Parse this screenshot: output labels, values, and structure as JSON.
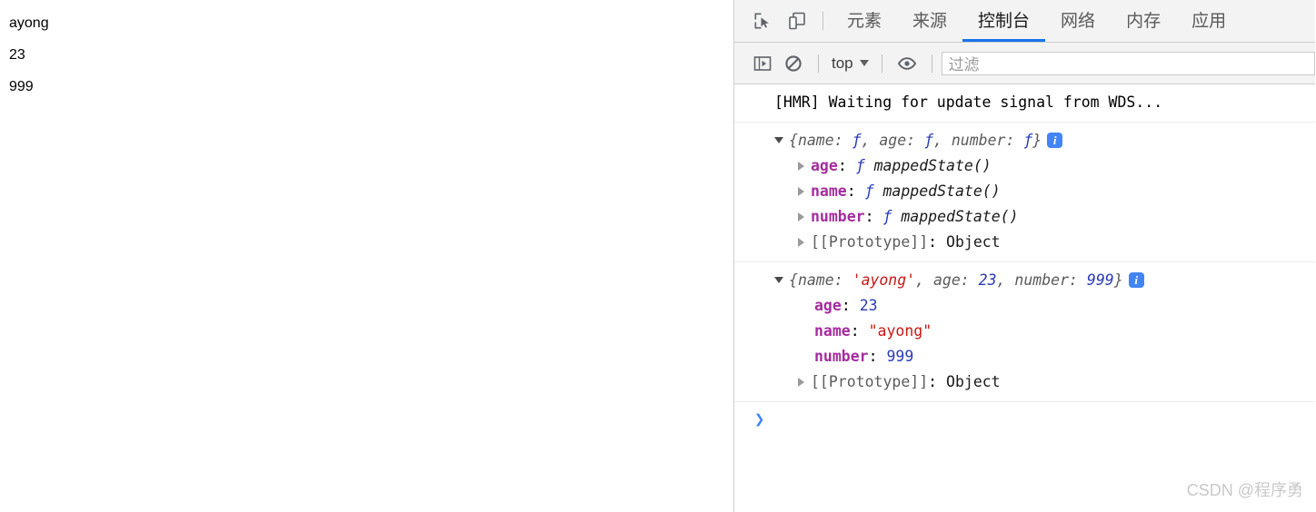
{
  "page": {
    "lines": [
      "ayong",
      "23",
      "999"
    ]
  },
  "devtools": {
    "toolbar_icons": {
      "inspect": "inspect-element-icon",
      "device": "device-toolbar-icon"
    },
    "tabs": [
      {
        "label": "元素",
        "active": false
      },
      {
        "label": "来源",
        "active": false
      },
      {
        "label": "控制台",
        "active": true
      },
      {
        "label": "网络",
        "active": false
      },
      {
        "label": "内存",
        "active": false
      },
      {
        "label": "应用",
        "active": false
      }
    ],
    "console_toolbar": {
      "sidebar_toggle": "console-sidebar-icon",
      "clear_console": "clear-console-icon",
      "context": "top",
      "eye": "live-expression-icon",
      "filter_placeholder": "过滤"
    },
    "console": {
      "messages": [
        {
          "type": "log",
          "text": "[HMR] Waiting for update signal from WDS..."
        },
        {
          "type": "object",
          "preview_open": "{",
          "preview_items": [
            {
              "key": "name",
              "value": "ƒ"
            },
            {
              "key": "age",
              "value": "ƒ"
            },
            {
              "key": "number",
              "value": "ƒ"
            }
          ],
          "preview_close": "}",
          "badge": "info-badge",
          "props": [
            {
              "key": "age",
              "kw": "ƒ",
              "value": "mappedState()",
              "kind": "function",
              "expandable": true
            },
            {
              "key": "name",
              "kw": "ƒ",
              "value": "mappedState()",
              "kind": "function",
              "expandable": true
            },
            {
              "key": "number",
              "kw": "ƒ",
              "value": "mappedState()",
              "kind": "function",
              "expandable": true
            },
            {
              "key": "[[Prototype]]",
              "value": "Object",
              "kind": "object",
              "expandable": true
            }
          ]
        },
        {
          "type": "object",
          "preview_open": "{",
          "preview_items": [
            {
              "key": "name",
              "value": "'ayong'",
              "kind": "string"
            },
            {
              "key": "age",
              "value": "23",
              "kind": "number"
            },
            {
              "key": "number",
              "value": "999",
              "kind": "number"
            }
          ],
          "preview_close": "}",
          "badge": "info-badge",
          "props": [
            {
              "key": "age",
              "value": "23",
              "kind": "number",
              "expandable": false
            },
            {
              "key": "name",
              "value": "\"ayong\"",
              "kind": "string",
              "expandable": false
            },
            {
              "key": "number",
              "value": "999",
              "kind": "number",
              "expandable": false
            },
            {
              "key": "[[Prototype]]",
              "value": "Object",
              "kind": "object",
              "expandable": true
            }
          ]
        }
      ],
      "prompt_caret": "❯"
    }
  },
  "watermark": "CSDN @程序勇",
  "colors": {
    "accent": "#1a73e8",
    "string": "#c41a16",
    "number": "#2a3ab8",
    "key": "#a52b9e",
    "badge": "#4285f4"
  }
}
